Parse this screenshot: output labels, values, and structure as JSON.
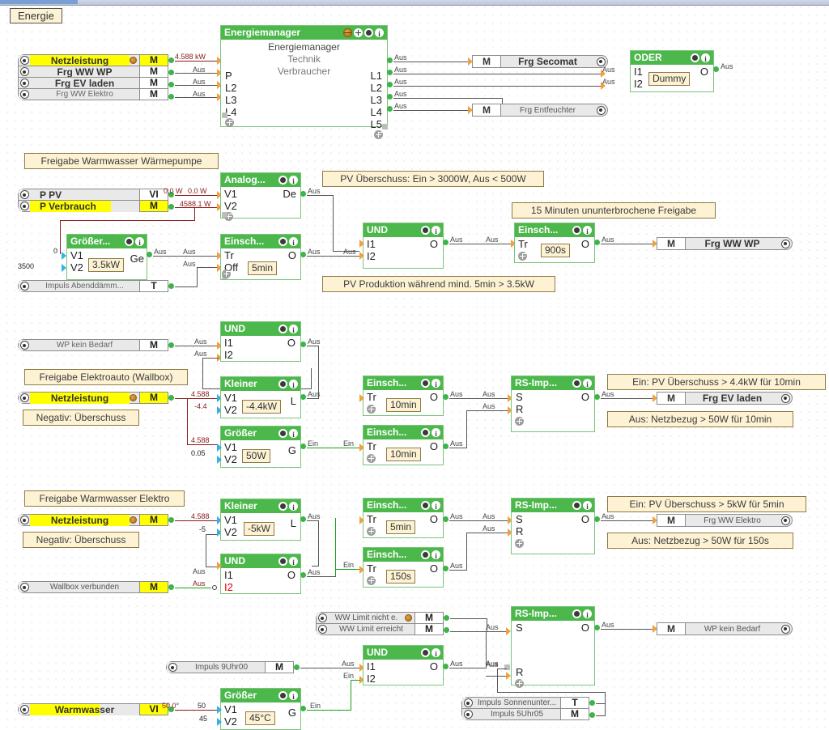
{
  "app": {
    "tab_label": "Energie"
  },
  "sections": {
    "s1_title": "Energiemanager",
    "s2_title": "Freigabe Warmwasser Wärmepumpe",
    "s3_title": "Freigabe Elektroauto (Wallbox)",
    "s4_title": "Freigabe Warmwasser Elektro"
  },
  "notes": {
    "pv_ueberschuss": "PV Überschuss: Ein > 3000W, Aus < 500W",
    "freigabe_15min": "15 Minuten ununterbrochene Freigabe",
    "pv_produktion": "PV Produktion während mind. 5min > 3.5kW",
    "neg_ueberschuss_1": "Negativ: Überschuss",
    "neg_ueberschuss_2": "Negativ: Überschuss",
    "ev_ein": "Ein: PV Überschuss > 4.4kW für 10min",
    "ev_aus": "Aus: Netzbezug > 50W für 10min",
    "ww_ein": "Ein: PV Überschuss > 5kW für 5min",
    "ww_aus": "Aus: Netzbezug > 50W für 150s"
  },
  "blocks": {
    "energiemanager": {
      "header": "Energiemanager",
      "label_top": "Energiemanager",
      "label_mid": "Technik",
      "label_bot": "Verbraucher",
      "inputs": [
        "P",
        "L2",
        "L3",
        "L4"
      ],
      "outputs": [
        "L1",
        "L2",
        "L3",
        "L4",
        "L5"
      ]
    },
    "oder": {
      "header": "ODER",
      "inputs": [
        "I1",
        "I2"
      ],
      "outputs": [
        "O"
      ],
      "chip": "Dummy"
    },
    "analog": {
      "header": "Analog...",
      "inputs": [
        "V1",
        "V2"
      ],
      "outputs": [
        "De"
      ]
    },
    "groesser_35": {
      "header": "Größer...",
      "inputs": [
        "V1",
        "V2"
      ],
      "outputs": [
        "Ge"
      ],
      "chip": "3.5kW"
    },
    "einsch_off5": {
      "header": "Einsch...",
      "inputs": [
        "Tr",
        "Off"
      ],
      "outputs": [
        "O"
      ],
      "chip": "5min"
    },
    "und_ww": {
      "header": "UND",
      "inputs": [
        "I1",
        "I2"
      ],
      "outputs": [
        "O"
      ]
    },
    "einsch_900": {
      "header": "Einsch...",
      "inputs": [
        "Tr"
      ],
      "outputs": [
        "O"
      ],
      "chip": "900s"
    },
    "und_ev": {
      "header": "UND",
      "inputs": [
        "I1",
        "I2"
      ],
      "outputs": [
        "O"
      ]
    },
    "kleiner_44": {
      "header": "Kleiner",
      "inputs": [
        "V1",
        "V2"
      ],
      "outputs": [
        "L"
      ],
      "chip": "-4.4kW"
    },
    "groesser_50w": {
      "header": "Größer",
      "inputs": [
        "V1",
        "V2"
      ],
      "outputs": [
        "G"
      ],
      "chip": "50W"
    },
    "einsch_10min_a": {
      "header": "Einsch...",
      "inputs": [
        "Tr"
      ],
      "outputs": [
        "O"
      ],
      "chip": "10min"
    },
    "einsch_10min_b": {
      "header": "Einsch...",
      "inputs": [
        "Tr"
      ],
      "outputs": [
        "O"
      ],
      "chip": "10min"
    },
    "rs_ev": {
      "header": "RS-Imp...",
      "inputs": [
        "S",
        "R"
      ],
      "outputs": [
        "O"
      ]
    },
    "kleiner_5kw": {
      "header": "Kleiner",
      "inputs": [
        "V1",
        "V2"
      ],
      "outputs": [
        "L"
      ],
      "chip": "-5kW"
    },
    "und_wb": {
      "header": "UND",
      "inputs": [
        "I1",
        "I2"
      ],
      "outputs": [
        "O"
      ]
    },
    "einsch_5min": {
      "header": "Einsch...",
      "inputs": [
        "Tr"
      ],
      "outputs": [
        "O"
      ],
      "chip": "5min"
    },
    "einsch_150s": {
      "header": "Einsch...",
      "inputs": [
        "Tr"
      ],
      "outputs": [
        "O"
      ],
      "chip": "150s"
    },
    "rs_wwe": {
      "header": "RS-Imp...",
      "inputs": [
        "S",
        "R"
      ],
      "outputs": [
        "O"
      ]
    },
    "und_wp": {
      "header": "UND",
      "inputs": [
        "I1",
        "I2"
      ],
      "outputs": [
        "O"
      ]
    },
    "groesser_45": {
      "header": "Größer",
      "inputs": [
        "V1",
        "V2"
      ],
      "outputs": [
        "G"
      ],
      "chip": "45°C"
    },
    "rs_wp": {
      "header": "RS-Imp...",
      "inputs": [
        "S",
        "R"
      ],
      "outputs": [
        "O"
      ]
    }
  },
  "io_inputs": {
    "top_group": [
      {
        "name": "Netzleistung",
        "type": "M",
        "highlight": true,
        "knx": true
      },
      {
        "name": "Frg WW WP",
        "type": "M",
        "highlight": false,
        "bold": true
      },
      {
        "name": "Frg EV laden",
        "type": "M",
        "highlight": false,
        "bold": true
      },
      {
        "name": "Frg WW Elektro",
        "type": "M",
        "highlight": false,
        "bold": false
      }
    ],
    "pv_group": [
      {
        "name": "P  PV",
        "type": "VI",
        "highlight": false,
        "bold": true
      },
      {
        "name": "P  Verbrauch",
        "type": "M",
        "highlight": true,
        "bold": true
      }
    ],
    "impuls_abend": {
      "name": "Impuls Abenddämm...",
      "type": "T"
    },
    "wp_kein_bedarf_in": {
      "name": "WP kein Bedarf",
      "type": "M"
    },
    "netzleistung_ev": {
      "name": "Netzleistung",
      "type": "M",
      "knx": true
    },
    "netzleistung_ww": {
      "name": "Netzleistung",
      "type": "M",
      "knx": true
    },
    "wallbox_verbunden": {
      "name": "Wallbox verbunden",
      "type": "M"
    },
    "ww_limit_group": [
      {
        "name": "WW Limit nicht e.",
        "type": "M",
        "knx": true
      },
      {
        "name": "WW Limit erreicht",
        "type": "M",
        "knx": false
      }
    ],
    "impuls_9uhr": {
      "name": "Impuls 9Uhr00",
      "type": "M"
    },
    "warmwasser": {
      "name": "Warmwasser",
      "type": "VI",
      "highlight": true
    },
    "impuls_group": [
      {
        "name": "Impuls Sonnenunter...",
        "type": "T"
      },
      {
        "name": "Impuls 5Uhr05",
        "type": "M"
      }
    ]
  },
  "io_outputs": {
    "frg_secomat": {
      "name": "Frg Secomat",
      "type": "M",
      "small": false
    },
    "frg_entfeuchter": {
      "name": "Frg Entfeuchter",
      "type": "M",
      "small": true
    },
    "frg_ww_wp": {
      "name": "Frg WW WP",
      "type": "M",
      "small": false
    },
    "frg_ev_laden": {
      "name": "Frg EV laden",
      "type": "M",
      "small": false
    },
    "frg_ww_elektro": {
      "name": "Frg WW Elektro",
      "type": "M",
      "small": true
    },
    "wp_kein_bedarf": {
      "name": "WP kein Bedarf",
      "type": "M",
      "small": true
    }
  },
  "wire_values": {
    "netz_kw": "4.588 kW",
    "pv_w_a": "0.0 W",
    "pv_w_b": "0.0 W",
    "verbrauch_w": "4588.1 W",
    "groesser_v1": "0",
    "groesser_v2": "3500",
    "ev_v1": "4.588",
    "ev_v2": "-4.4",
    "ev2_v1": "4.588",
    "ev2_v2": "0.05",
    "ww_v1": "4.588",
    "ww_v2": "-5",
    "warm_val": "50.0°",
    "warm_v1": "50",
    "warm_v2": "45",
    "aus": "Aus",
    "ein": "Ein"
  },
  "colors": {
    "block_header": "#4cb84c",
    "block_border": "#7bc47b",
    "note_bg": "#fdf3d4",
    "highlight": "#ffff00",
    "wire_signal": "#555555",
    "wire_value": "#8b1a1a",
    "wire_active": "#18a018"
  }
}
